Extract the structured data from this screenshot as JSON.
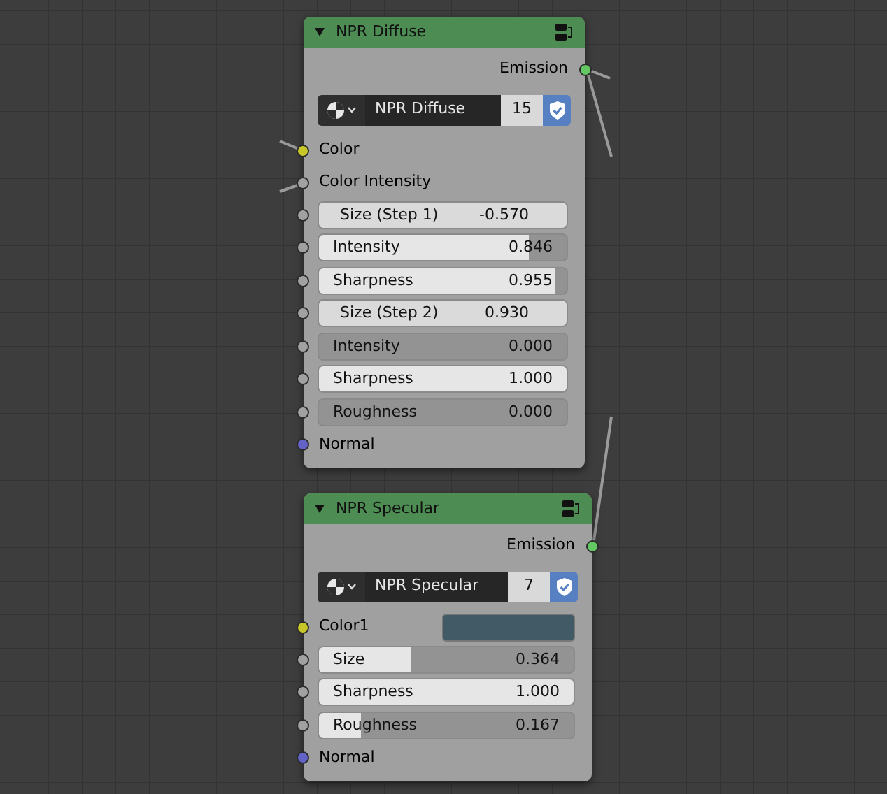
{
  "nodes": [
    {
      "title": "NPR Diffuse",
      "rows": [
        {
          "kind": "output",
          "label": "Emission",
          "color": "#63c763"
        },
        {
          "kind": "datablock",
          "name": "NPR Diffuse",
          "users": "15"
        },
        {
          "kind": "input",
          "label": "Color",
          "color": "#c7c729"
        },
        {
          "kind": "input",
          "label": "Color Intensity",
          "color": "#a1a1a1"
        },
        {
          "kind": "field",
          "label": "Size (Step 1)",
          "value": "-0.570",
          "color": "#a1a1a1"
        },
        {
          "kind": "slider",
          "label": "Intensity",
          "value": "0.846",
          "level": 0.846,
          "color": "#a1a1a1"
        },
        {
          "kind": "slider",
          "label": "Sharpness",
          "value": "0.955",
          "level": 0.955,
          "color": "#a1a1a1"
        },
        {
          "kind": "field",
          "label": "Size (Step 2)",
          "value": "0.930",
          "color": "#a1a1a1"
        },
        {
          "kind": "slider",
          "label": "Intensity",
          "value": "0.000",
          "level": 0,
          "color": "#a1a1a1"
        },
        {
          "kind": "slider",
          "label": "Sharpness",
          "value": "1.000",
          "level": 1,
          "color": "#a1a1a1"
        },
        {
          "kind": "slider",
          "label": "Roughness",
          "value": "0.000",
          "level": 0,
          "color": "#a1a1a1"
        },
        {
          "kind": "input",
          "label": "Normal",
          "color": "#6363c7"
        }
      ]
    },
    {
      "title": "NPR Specular",
      "rows": [
        {
          "kind": "output",
          "label": "Emission",
          "color": "#63c763"
        },
        {
          "kind": "datablock",
          "name": "NPR Specular",
          "users": "7"
        },
        {
          "kind": "swatch",
          "label": "Color1",
          "swatch": {
            "color": "#415a66"
          },
          "color": "#c7c729"
        },
        {
          "kind": "slider",
          "label": "Size",
          "value": "0.364",
          "level": 0.364,
          "color": "#a1a1a1"
        },
        {
          "kind": "slider",
          "label": "Sharpness",
          "value": "1.000",
          "level": 1,
          "color": "#a1a1a1"
        },
        {
          "kind": "slider",
          "label": "Roughness",
          "value": "0.167",
          "level": 0.167,
          "color": "#a1a1a1"
        },
        {
          "kind": "input",
          "label": "Normal",
          "color": "#6363c7"
        }
      ]
    }
  ]
}
